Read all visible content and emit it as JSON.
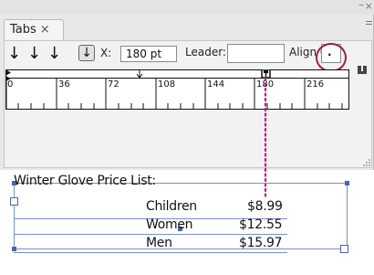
{
  "panel": {
    "tab_label": "Tabs",
    "tab_close": "×",
    "minimize": "–",
    "close": "×",
    "tools": [
      {
        "name": "left-justified-tab-button",
        "glyph": "↓"
      },
      {
        "name": "center-justified-tab-button",
        "glyph": "↓"
      },
      {
        "name": "right-justified-tab-button",
        "glyph": "↓"
      },
      {
        "name": "decimal-justified-tab-button",
        "glyph": "↓"
      }
    ],
    "x_label": "X:",
    "x_value": "180 pt",
    "leader_label": "Leader:",
    "leader_value": "",
    "align_on_label": "Align On:",
    "align_on_value": ".",
    "ruler_ticks": [
      "0",
      "36",
      "72",
      "108",
      "144",
      "180",
      "216"
    ]
  },
  "document": {
    "heading": "Winter Glove Price List:",
    "rows": [
      {
        "item": "Children",
        "price": "$8.99"
      },
      {
        "item": "Women",
        "price": "$12.55"
      },
      {
        "item": "Men",
        "price": "$15.97"
      }
    ]
  },
  "colors": {
    "highlight_ring": "#9c1f3b",
    "guide_dots": "#c0177d",
    "frame": "#7b8fc9"
  }
}
